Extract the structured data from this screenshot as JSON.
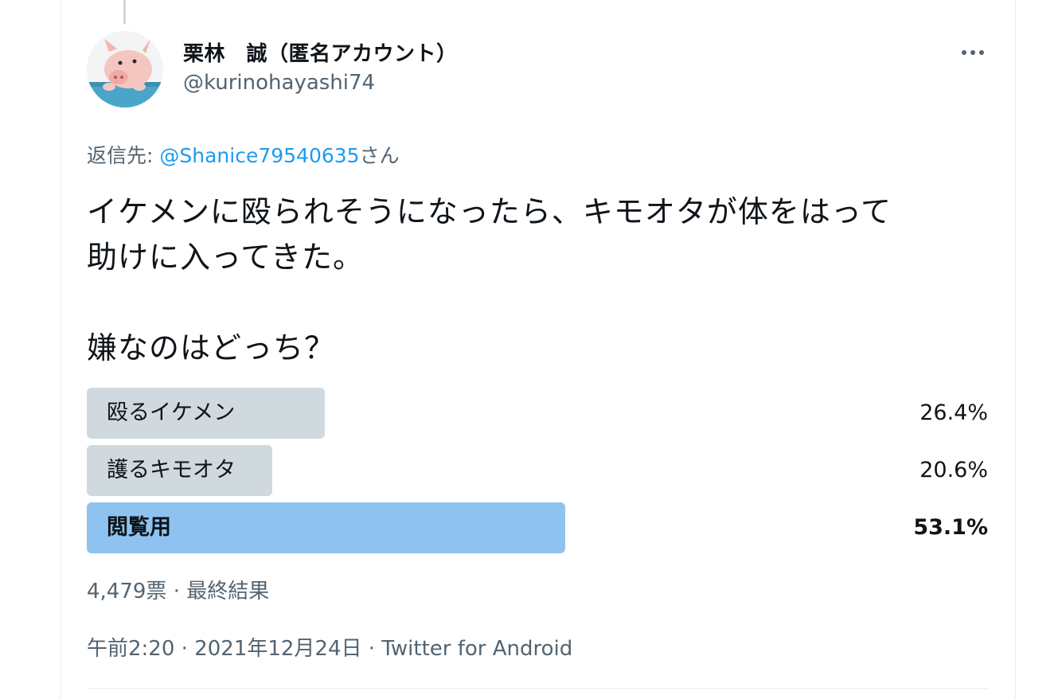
{
  "tweet": {
    "display_name": "栗林　誠（匿名アカウント）",
    "handle": "@kurinohayashi74",
    "reply_prefix": "返信先: ",
    "reply_mention": "@Shanice79540635",
    "reply_suffix": "さん",
    "text": "イケメンに殴られそうになったら、キモオタが体をはって\n助けに入ってきた。\n\n嫌なのはどっち？",
    "avatar_icon": "pig-avatar-icon",
    "more_icon": "more-options-icon"
  },
  "poll": {
    "options": [
      {
        "label": "殴るイケメン",
        "percent_text": "26.4%",
        "percent": 26.4,
        "winner": false
      },
      {
        "label": "護るキモオタ",
        "percent_text": "20.6%",
        "percent": 20.6,
        "winner": false
      },
      {
        "label": "閲覧用",
        "percent_text": "53.1%",
        "percent": 53.1,
        "winner": true
      }
    ],
    "summary": "4,479票 · 最終結果"
  },
  "meta": {
    "timestamp": "午前2:20 · 2021年12月24日 · Twitter for Android"
  },
  "colors": {
    "accent": "#1d9bf0",
    "poll_bar": "#cfd9de",
    "poll_winner_bar": "#8ec2f0",
    "secondary_text": "#536471"
  }
}
